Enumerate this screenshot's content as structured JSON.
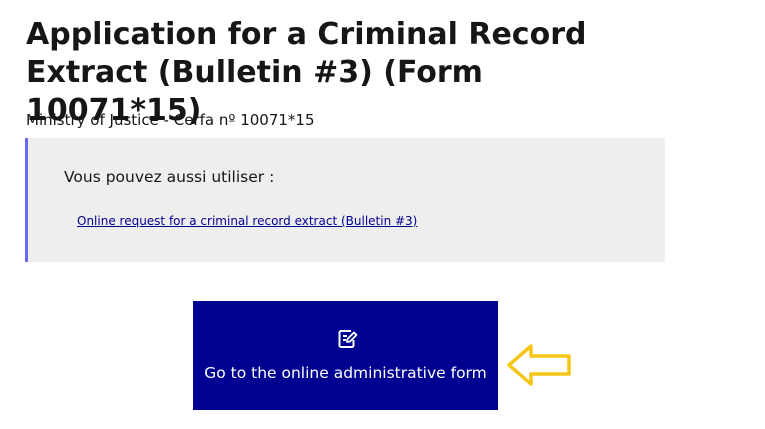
{
  "page": {
    "title": "Application for a Criminal Record Extract (Bulletin #3) (Form 10071*15)",
    "subtitle": "Ministry of Justice - Cerfa nº 10071*15"
  },
  "callout": {
    "title": "Vous pouvez aussi utiliser :",
    "link_label": "Online request for a criminal record extract (Bulletin #3)",
    "accent_color": "#6a6af4",
    "background_color": "#eeeeee"
  },
  "cta": {
    "label": "Go to the online administrative form",
    "icon": "edit-form-icon",
    "background_color": "#000091"
  },
  "annotation": {
    "icon": "arrow-left-icon",
    "color": "#f5c518"
  }
}
